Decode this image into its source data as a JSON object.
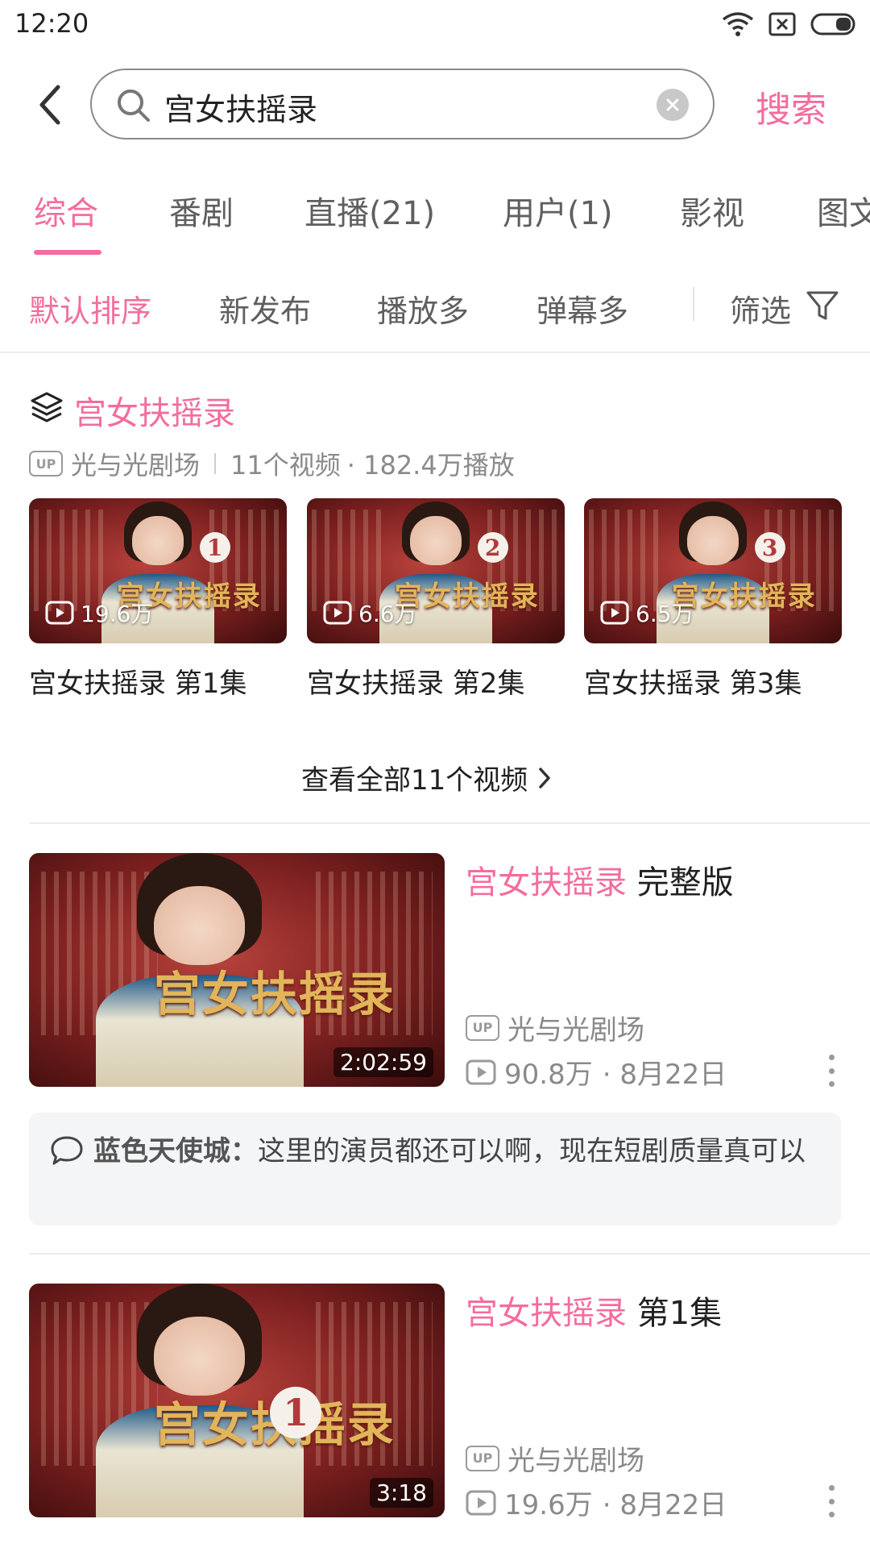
{
  "status_bar": {
    "time": "12:20"
  },
  "search": {
    "query": "宫女扶摇录",
    "button_label": "搜索"
  },
  "tabs": [
    "综合",
    "番剧",
    "直播(21)",
    "用户(1)",
    "影视",
    "图文"
  ],
  "sort": {
    "options": [
      "默认排序",
      "新发布",
      "播放多",
      "弹幕多"
    ],
    "filter_label": "筛选"
  },
  "collection": {
    "title": "宫女扶摇录",
    "up_badge": "UP",
    "uploader": "光与光剧场",
    "count": "11个视频",
    "plays": "· 182.4万播放",
    "episodes": [
      {
        "num": "1",
        "views": "19.6万",
        "title": "宫女扶摇录 第1集"
      },
      {
        "num": "2",
        "views": "6.6万",
        "title": "宫女扶摇录 第2集"
      },
      {
        "num": "3",
        "views": "6.5万",
        "title": "宫女扶摇录 第3集"
      }
    ],
    "view_all": "查看全部11个视频"
  },
  "results": [
    {
      "title_highlight": "宫女扶摇录",
      "title_rest": "完整版",
      "duration": "2:02:59",
      "thumb_text": "宫女扶摇录",
      "up_badge": "UP",
      "uploader": "光与光剧场",
      "views": "90.8万",
      "date": "· 8月22日",
      "comment_user": "蓝色天使城：",
      "comment_text": "这里的演员都还可以啊，现在短剧质量真可以"
    },
    {
      "title_highlight": "宫女扶摇录",
      "title_rest": "第1集",
      "duration": "3:18",
      "badge_num": "1",
      "thumb_text": "宫女扶摇录",
      "up_badge": "UP",
      "uploader": "光与光剧场",
      "views": "19.6万",
      "date": "· 8月22日"
    }
  ],
  "colors": {
    "accent": "#f36d9e",
    "text": "#212121",
    "muted": "#8a8a8a"
  }
}
